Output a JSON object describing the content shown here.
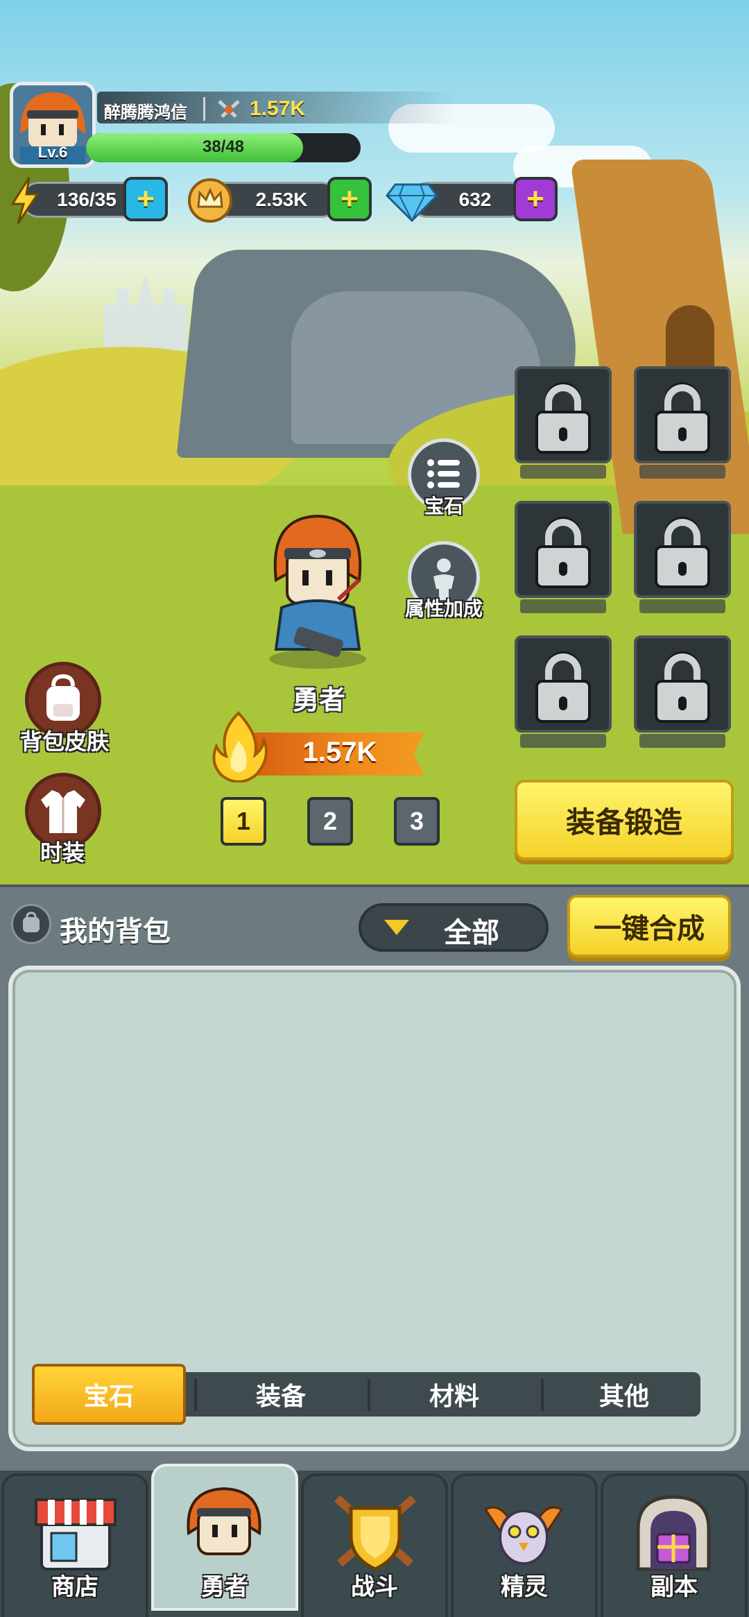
{
  "player": {
    "name": "醉腾腾鸿信",
    "level": "Lv.6",
    "power": "1.57K",
    "xp_text": "38/48",
    "xp_fraction": 0.79
  },
  "resources": {
    "energy": "136/35",
    "gold": "2.53K",
    "gems": "632"
  },
  "side_buttons": {
    "gem": "宝石",
    "attributes": "属性加成",
    "bag_skin": "背包皮肤",
    "fashion": "时装"
  },
  "hero": {
    "name": "勇者",
    "power": "1.57K"
  },
  "pages": [
    "1",
    "2",
    "3"
  ],
  "active_page": 0,
  "forge_button": "装备锻造",
  "bag": {
    "title": "我的背包",
    "filter": "全部",
    "merge_button": "一键合成",
    "tabs": [
      "宝石",
      "装备",
      "材料",
      "其他"
    ],
    "active_tab": 0
  },
  "nav": [
    {
      "label": "商店",
      "icon": "shop-icon"
    },
    {
      "label": "勇者",
      "icon": "hero-icon"
    },
    {
      "label": "战斗",
      "icon": "battle-icon"
    },
    {
      "label": "精灵",
      "icon": "spirit-icon"
    },
    {
      "label": "副本",
      "icon": "dungeon-icon"
    }
  ],
  "active_nav": 1,
  "colors": {
    "accent_yellow": "#f5d22a",
    "xp_green": "#3fbf37",
    "gem_purple": "#a23ad8",
    "energy_cyan": "#27b8e6"
  }
}
